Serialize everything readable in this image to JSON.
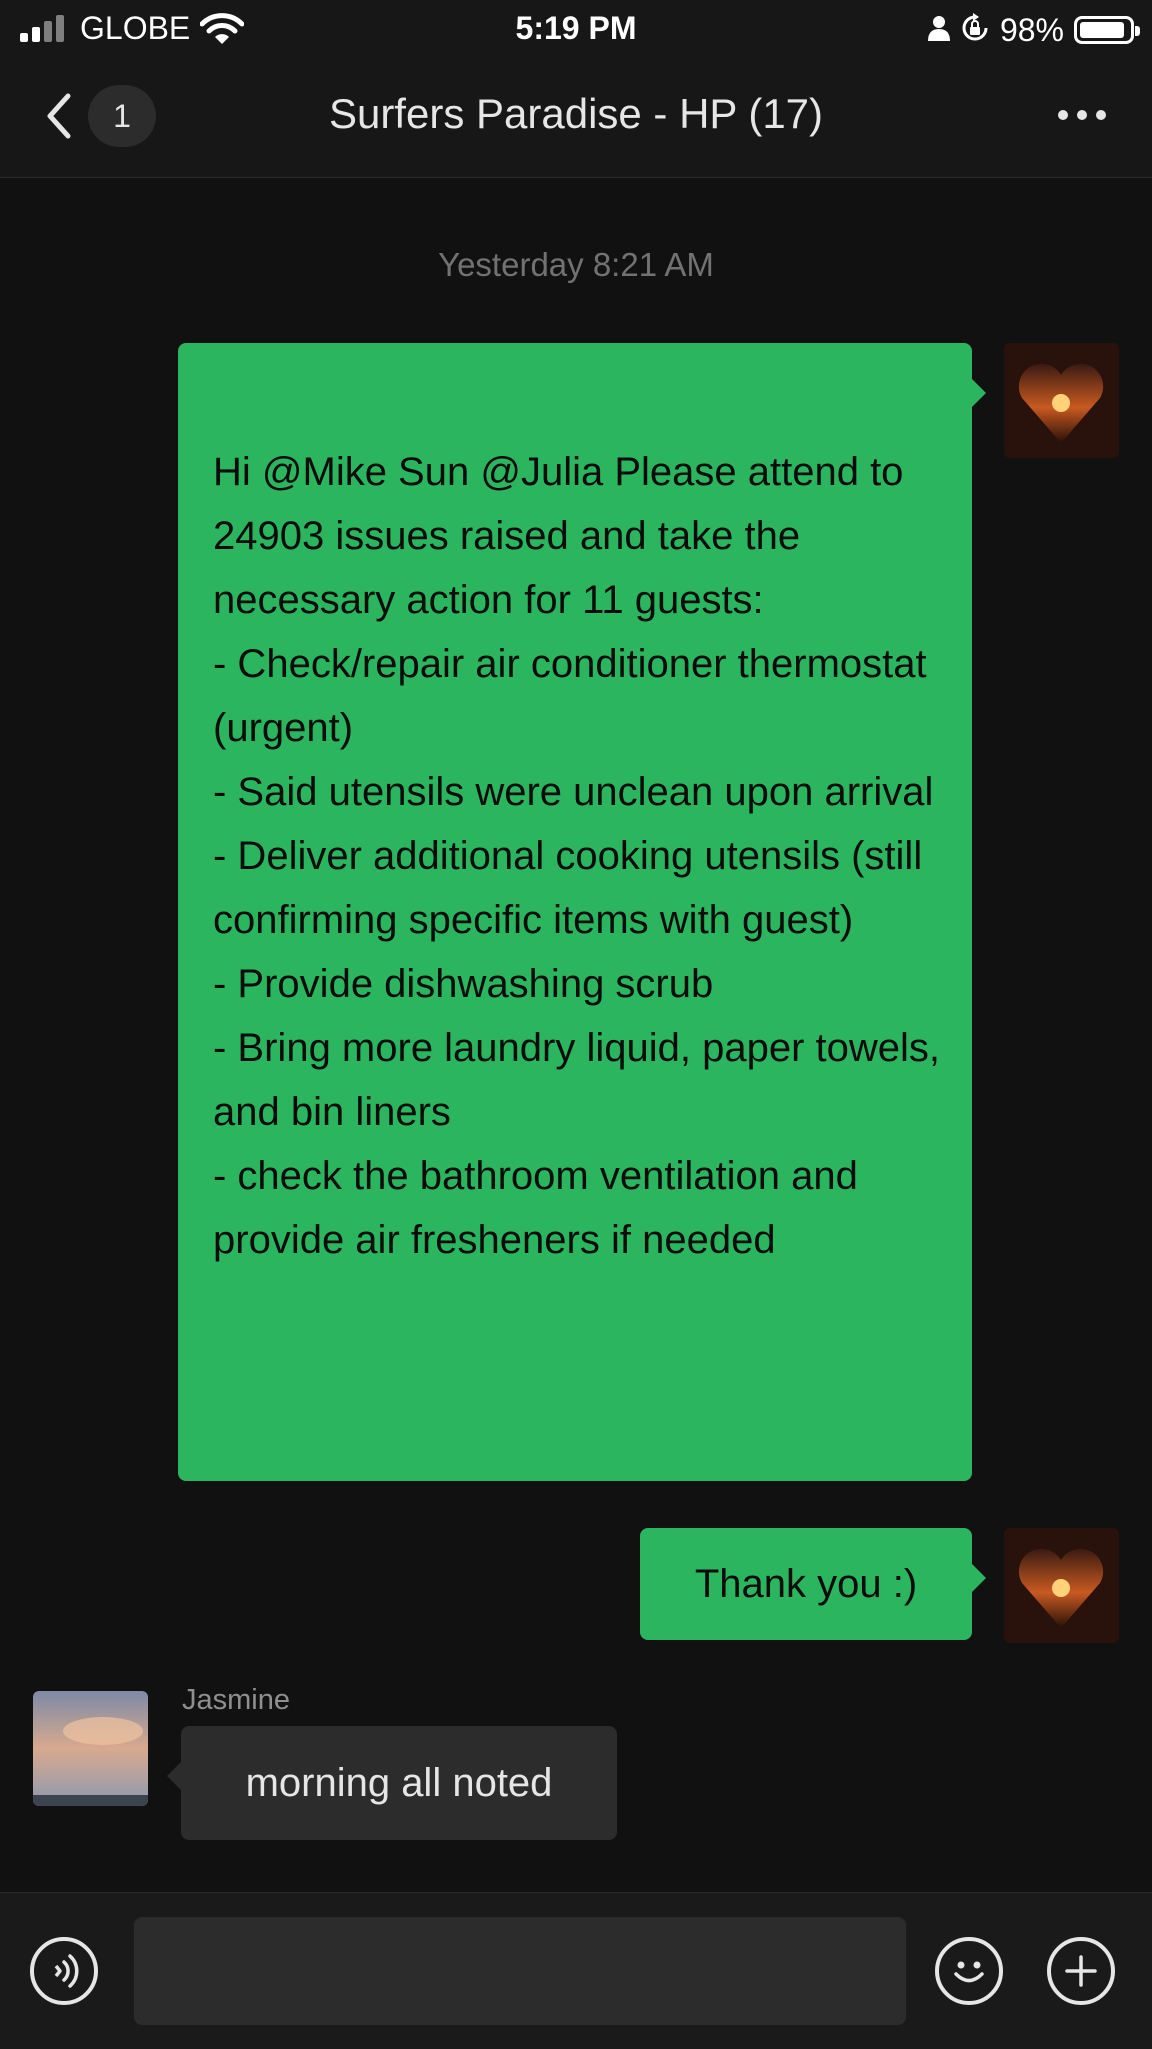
{
  "status_bar": {
    "carrier": "GLOBE",
    "time": "5:19 PM",
    "battery_percent": "98%",
    "battery_level": 0.98
  },
  "nav": {
    "unread_count": "1",
    "title": "Surfers Paradise - HP (17)",
    "more_icon": "more-dots-icon",
    "back_icon": "chevron-left-icon"
  },
  "chat": {
    "timestamp": "Yesterday 8:21 AM",
    "messages": [
      {
        "direction": "outgoing",
        "text": "Hi @Mike Sun @Julia Please attend to 24903 issues raised and take the necessary action for 11 guests:\n- Check/repair air conditioner thermostat (urgent)\n- Said utensils were unclean upon arrival\n- Deliver additional cooking utensils (still confirming specific items with guest)\n- Provide dishwashing scrub\n- Bring more laundry liquid, paper towels, and bin liners\n- check the bathroom ventilation and provide air fresheners if needed"
      },
      {
        "direction": "outgoing",
        "text": "Thank you :)"
      },
      {
        "direction": "incoming",
        "sender": "Jasmine",
        "text": "morning all noted"
      }
    ]
  },
  "input_bar": {
    "voice_icon": "voice-input-icon",
    "text_value": "",
    "emoji_icon": "emoji-icon",
    "plus_icon": "plus-icon"
  },
  "colors": {
    "background": "#111111",
    "outgoing_bubble": "#2bb55e",
    "incoming_bubble": "#2c2c2c",
    "timestamp": "#727272"
  }
}
